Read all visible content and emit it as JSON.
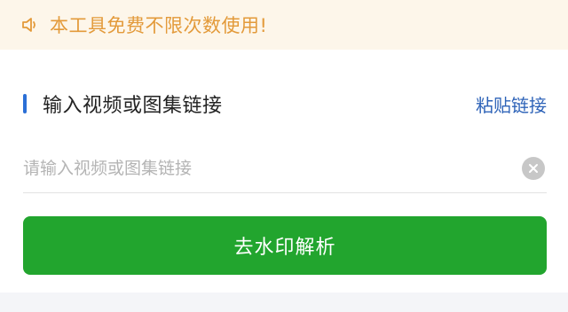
{
  "notice": {
    "icon": "speaker-icon",
    "text": "本工具免费不限次数使用!",
    "color": "#e39a3a",
    "background": "#fdf6ea"
  },
  "section": {
    "title": "输入视频或图集链接",
    "paste_label": "粘贴链接",
    "accent_color": "#2b6fd6"
  },
  "input": {
    "placeholder": "请输入视频或图集链接",
    "value": "",
    "clear_icon": "clear-icon"
  },
  "submit": {
    "label": "去水印解析",
    "color": "#22a52e"
  }
}
